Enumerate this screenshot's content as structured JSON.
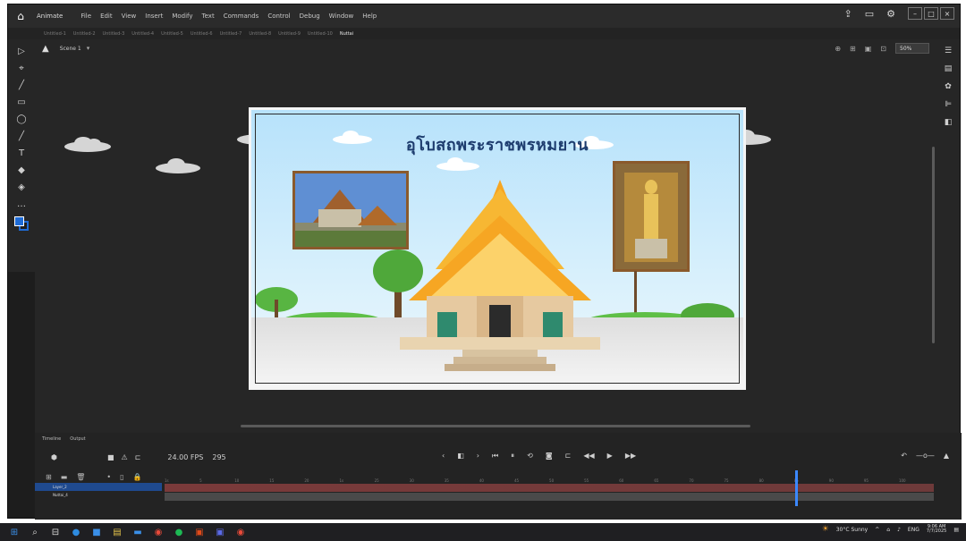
{
  "window": {
    "app_name": "Animate",
    "menu": [
      "File",
      "Edit",
      "View",
      "Insert",
      "Modify",
      "Text",
      "Commands",
      "Control",
      "Debug",
      "Window",
      "Help"
    ],
    "minimize": "–",
    "maximize": "□",
    "close": "×"
  },
  "doc_tabs": [
    "Untitled-1",
    "Untitled-2",
    "Untitled-3",
    "Untitled-4",
    "Untitled-5",
    "Untitled-6",
    "Untitled-7",
    "Untitled-8",
    "Untitled-9",
    "Untitled-10",
    "Nuttai"
  ],
  "editbar": {
    "scene": "Scene 1",
    "zoom": "50%"
  },
  "stage": {
    "title": "อุโบสถพระราชพรหมยาน",
    "background_color": "#c8e9fb"
  },
  "timeline": {
    "tabs": [
      "Timeline",
      "Output"
    ],
    "fps": "24.00 FPS",
    "current_frame": "295",
    "layers": [
      {
        "name": "Layer_2",
        "selected": true
      },
      {
        "name": "Nuttai_4",
        "selected": false
      }
    ],
    "ruler": [
      "1s",
      "5",
      "10",
      "15",
      "20",
      "1s",
      "25",
      "30",
      "35",
      "40",
      "45",
      "50",
      "55",
      "60",
      "65",
      "70",
      "75",
      "80",
      "85",
      "90",
      "95",
      "100"
    ]
  },
  "taskbar": {
    "weather": "30°C  Sunny",
    "lang": "ENG",
    "time": "9:06 AM",
    "date": "7/7/2025"
  },
  "colors": {
    "accent": "#1e6bd6",
    "playhead": "#3b88ff"
  }
}
